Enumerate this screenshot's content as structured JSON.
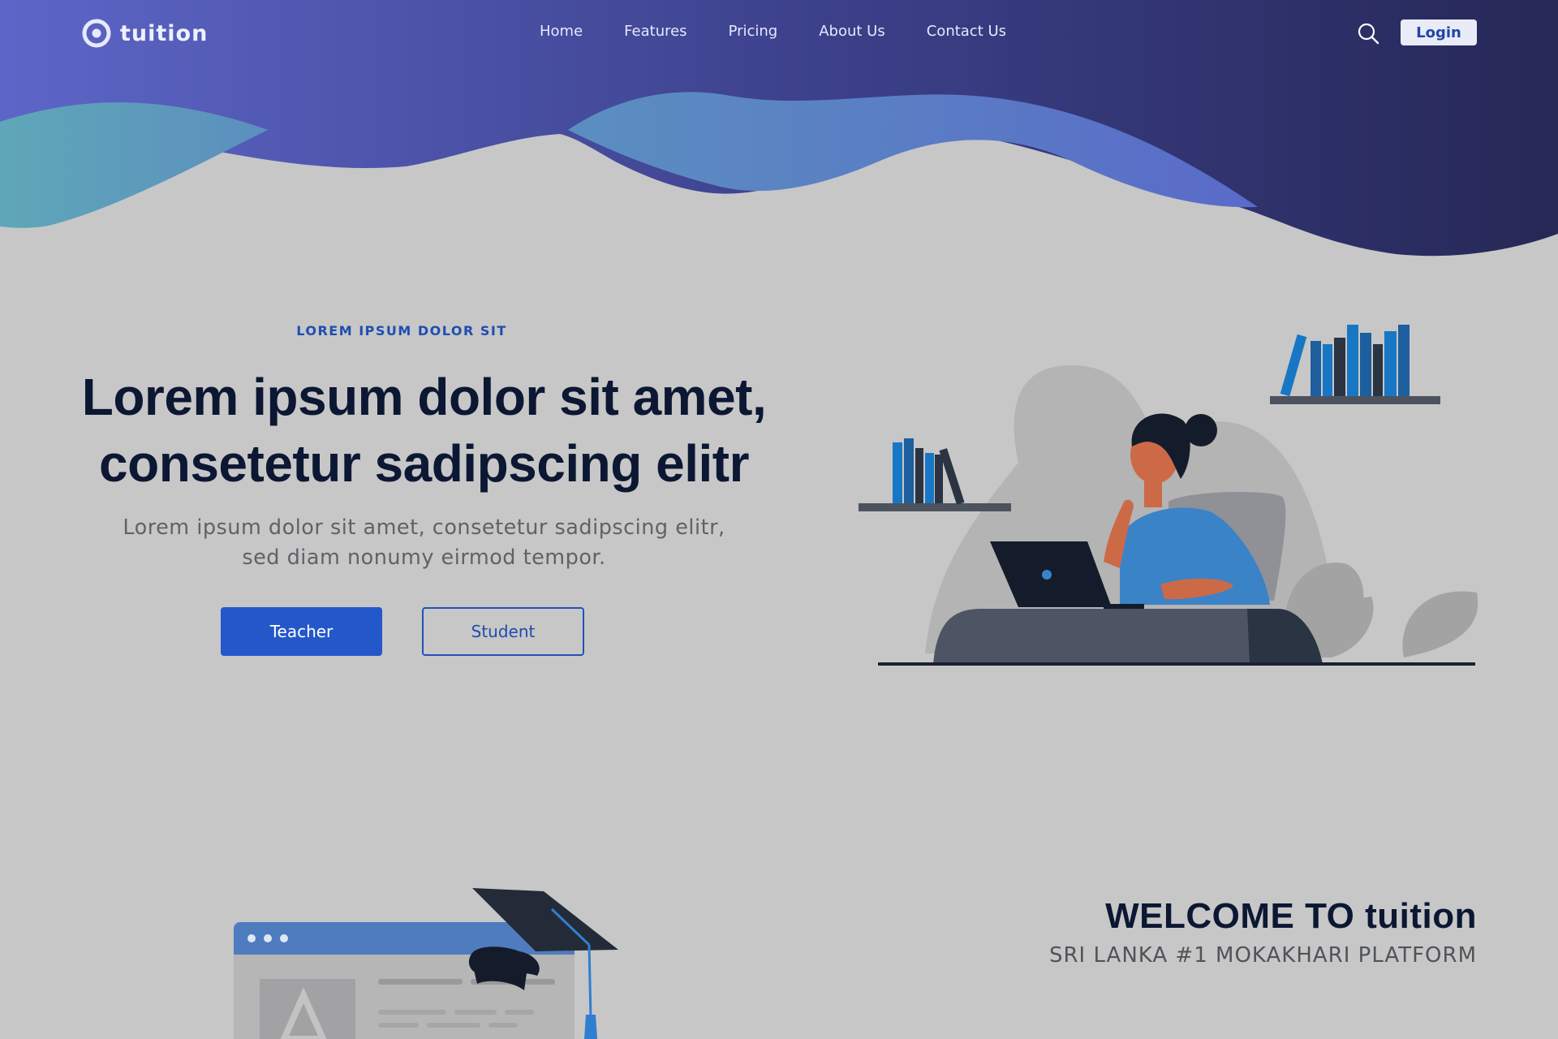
{
  "brand": {
    "name": "tuition",
    "logo_icon": "ring-logo-icon"
  },
  "nav": {
    "items": [
      "Home",
      "Features",
      "Pricing",
      "About Us",
      "Contact Us"
    ],
    "search_icon": "search-icon",
    "login_label": "Login"
  },
  "hero": {
    "eyebrow": "LOREM IPSUM DOLOR SIT",
    "title_line1": "Lorem ipsum dolor sit amet,",
    "title_line2": "consetetur sadipscing elitr",
    "subtitle_line1": "Lorem ipsum dolor sit amet, consetetur sadipscing elitr,",
    "subtitle_line2": "sed diam nonumy eirmod tempor.",
    "buttons": {
      "teacher": "Teacher",
      "student": "Student"
    }
  },
  "welcome": {
    "title": "WELCOME TO tuition",
    "subtitle": "SRI LANKA #1 MOKAKHARI PLATFORM"
  },
  "colors": {
    "background": "#c7c7c7",
    "header_gradient_start": "#5b63c6",
    "header_gradient_end": "#28295a",
    "primary": "#2457c9",
    "heading": "#0c1733"
  }
}
